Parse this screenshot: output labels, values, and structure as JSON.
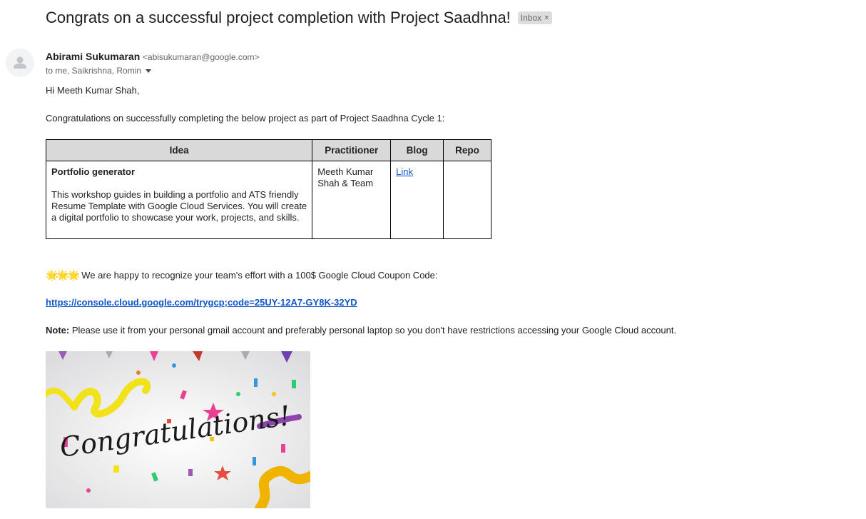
{
  "email": {
    "subject": "Congrats on a successful project completion with Project Saadhna!",
    "label": "Inbox",
    "label_close": "×",
    "sender_name": "Abirami Sukumaran",
    "sender_email": "<abisukumaran@google.com>",
    "recipients": "to me, Saikrishna, Romin"
  },
  "body": {
    "greeting": "Hi Meeth Kumar Shah,",
    "intro": "Congratulations on successfully completing the below project as part of Project Saadhna Cycle 1:",
    "table": {
      "headers": [
        "Idea",
        "Practitioner",
        "Blog",
        "Repo"
      ],
      "row": {
        "idea_title": "Portfolio generator",
        "idea_desc": "This workshop guides in building a portfolio and ATS friendly Resume Template with Google Cloud Services. You will create a digital portfolio to showcase your work, projects, and skills.",
        "practitioner": "Meeth Kumar Shah & Team",
        "blog_link": "Link",
        "repo": ""
      }
    },
    "stars": "🌟🌟🌟",
    "recognition": "We are happy to recognize your team's effort with a 100$ Google Cloud Coupon Code:",
    "coupon_url": "https://console.cloud.google.com/trygcp;code=25UY-12A7-GY8K-32YD",
    "note_label": "Note:",
    "note_text": "Please use it from your personal gmail account and preferably personal laptop so you don't have restrictions accessing your Google Cloud account.",
    "image_text": "Congratulations!"
  },
  "colors": {
    "link": "#1155cc",
    "table_header_bg": "#d9d9d9",
    "chip_bg": "#dddddd"
  }
}
